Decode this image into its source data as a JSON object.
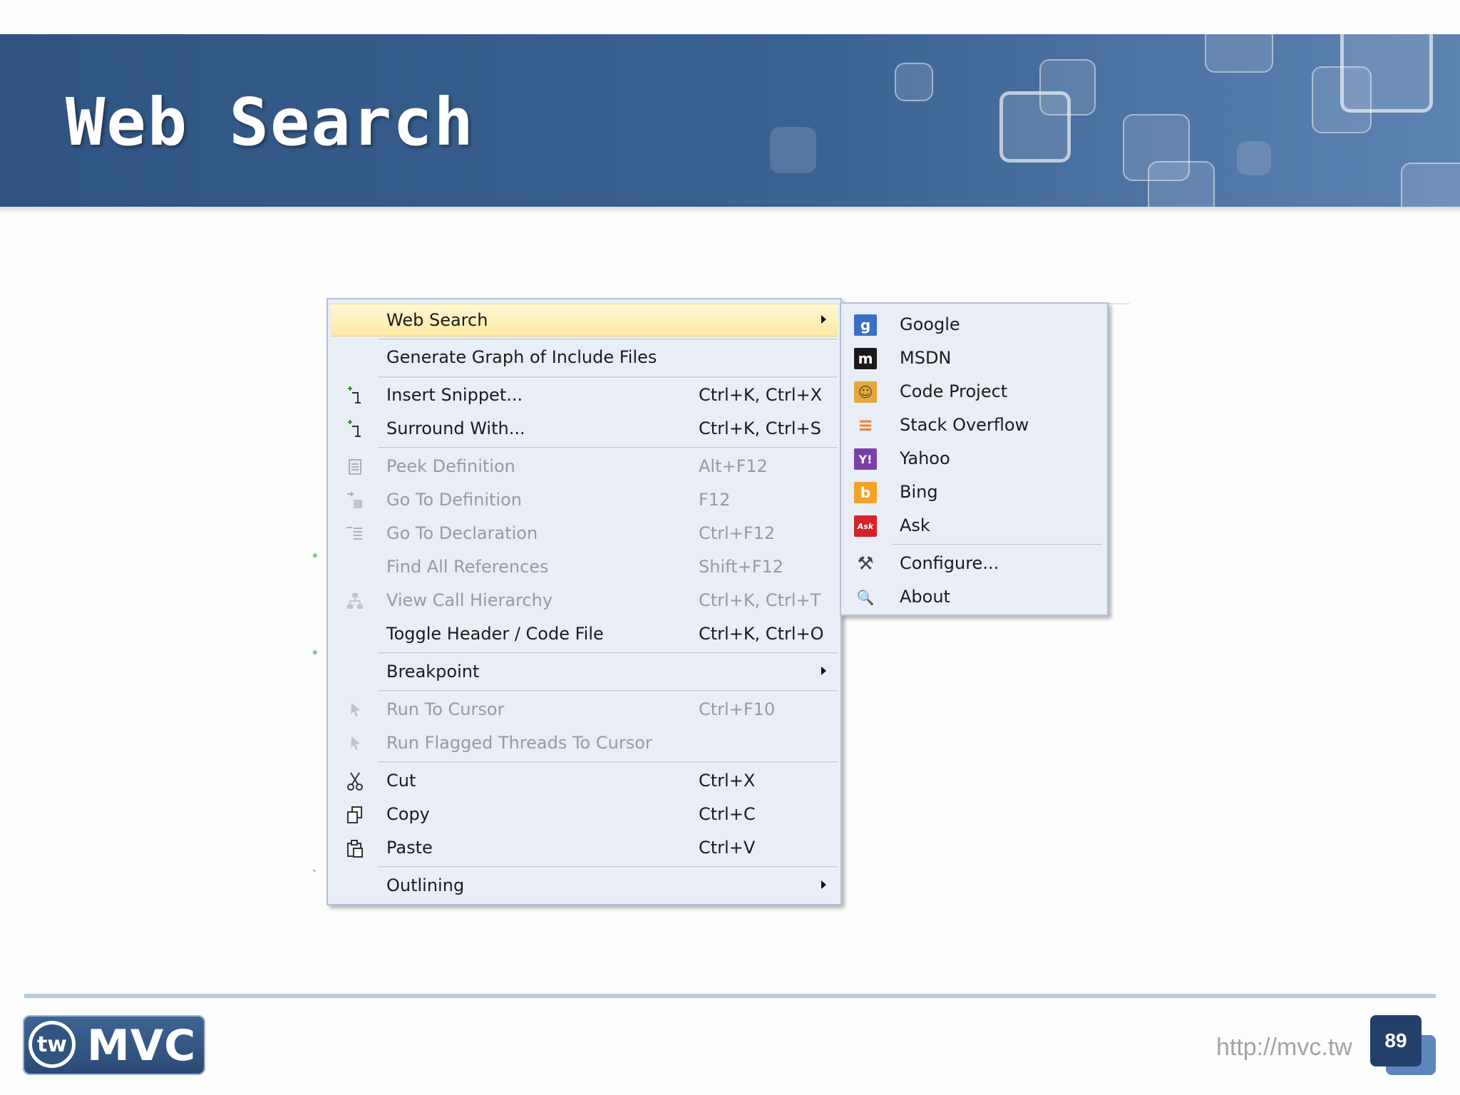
{
  "slide": {
    "title": "Web Search",
    "url": "http://mvc.tw",
    "page_number": "89",
    "logo": {
      "circle_text": "tw",
      "text": "MVC"
    }
  },
  "editor": {
    "glyphs": [
      "*",
      "*",
      "`"
    ]
  },
  "context_menu": {
    "items": [
      {
        "label": "Web Search",
        "shortcut": "",
        "icon": "",
        "state": "highlighted",
        "submenu": true
      },
      {
        "label": "Generate Graph of Include Files",
        "shortcut": "",
        "icon": "",
        "state": "enabled",
        "submenu": false
      },
      {
        "label": "Insert Snippet...",
        "shortcut": "Ctrl+K, Ctrl+X",
        "icon": "insert-snippet-icon",
        "state": "enabled",
        "submenu": false
      },
      {
        "label": "Surround With...",
        "shortcut": "Ctrl+K, Ctrl+S",
        "icon": "surround-with-icon",
        "state": "enabled",
        "submenu": false
      },
      {
        "label": "Peek Definition",
        "shortcut": "Alt+F12",
        "icon": "peek-definition-icon",
        "state": "disabled",
        "submenu": false
      },
      {
        "label": "Go To Definition",
        "shortcut": "F12",
        "icon": "go-to-definition-icon",
        "state": "disabled",
        "submenu": false
      },
      {
        "label": "Go To Declaration",
        "shortcut": "Ctrl+F12",
        "icon": "go-to-declaration-icon",
        "state": "disabled",
        "submenu": false
      },
      {
        "label": "Find All References",
        "shortcut": "Shift+F12",
        "icon": "",
        "state": "disabled",
        "submenu": false
      },
      {
        "label": "View Call Hierarchy",
        "shortcut": "Ctrl+K, Ctrl+T",
        "icon": "call-hierarchy-icon",
        "state": "disabled",
        "submenu": false
      },
      {
        "label": "Toggle Header / Code File",
        "shortcut": "Ctrl+K, Ctrl+O",
        "icon": "",
        "state": "enabled",
        "submenu": false
      },
      {
        "label": "Breakpoint",
        "shortcut": "",
        "icon": "",
        "state": "enabled",
        "submenu": true
      },
      {
        "label": "Run To Cursor",
        "shortcut": "Ctrl+F10",
        "icon": "run-to-cursor-icon",
        "state": "disabled",
        "submenu": false
      },
      {
        "label": "Run Flagged Threads To Cursor",
        "shortcut": "",
        "icon": "run-flagged-threads-icon",
        "state": "disabled",
        "submenu": false
      },
      {
        "label": "Cut",
        "shortcut": "Ctrl+X",
        "icon": "scissors-icon",
        "state": "enabled",
        "submenu": false
      },
      {
        "label": "Copy",
        "shortcut": "Ctrl+C",
        "icon": "copy-icon",
        "state": "enabled",
        "submenu": false
      },
      {
        "label": "Paste",
        "shortcut": "Ctrl+V",
        "icon": "paste-icon",
        "state": "enabled",
        "submenu": false
      },
      {
        "label": "Outlining",
        "shortcut": "",
        "icon": "",
        "state": "enabled",
        "submenu": true
      }
    ]
  },
  "web_search_submenu": {
    "items": [
      {
        "label": "Google",
        "icon": "google-icon",
        "icon_glyph": "g",
        "color": "#3b6fc6"
      },
      {
        "label": "MSDN",
        "icon": "msdn-icon",
        "icon_glyph": "m",
        "color": "#1a1a1a"
      },
      {
        "label": "Code Project",
        "icon": "code-project-icon",
        "icon_glyph": "☺",
        "color": "#e8a53a"
      },
      {
        "label": "Stack Overflow",
        "icon": "stack-overflow-icon",
        "icon_glyph": "≡",
        "color": "#ef8236"
      },
      {
        "label": "Yahoo",
        "icon": "yahoo-icon",
        "icon_glyph": "Y!",
        "color": "#7b3fa6"
      },
      {
        "label": "Bing",
        "icon": "bing-icon",
        "icon_glyph": "b",
        "color": "#f3a325"
      },
      {
        "label": "Ask",
        "icon": "ask-icon",
        "icon_glyph": "Ask",
        "color": "#d3232a"
      },
      {
        "label": "Configure...",
        "icon": "tools-icon",
        "icon_glyph": "⚒",
        "color": "transparent"
      },
      {
        "label": "About",
        "icon": "about-icon",
        "icon_glyph": "🔍",
        "color": "transparent"
      }
    ]
  }
}
